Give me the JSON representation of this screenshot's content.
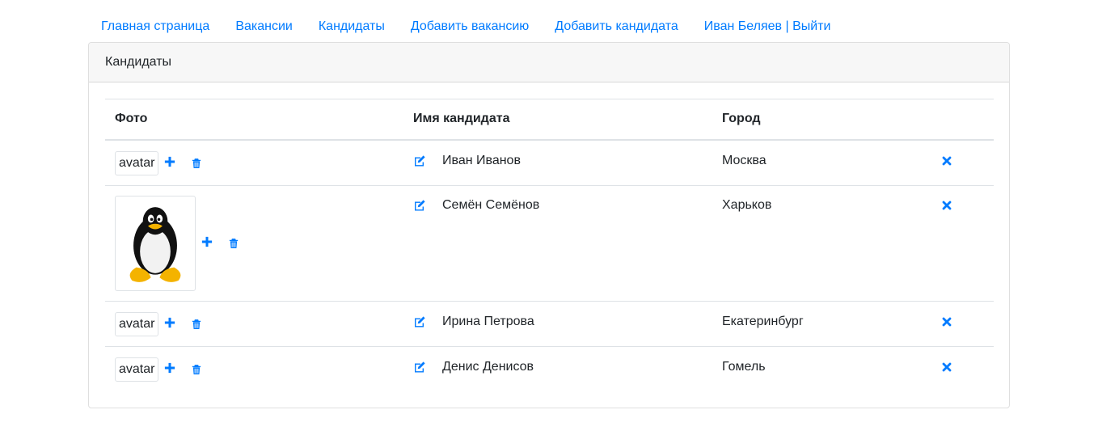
{
  "nav": {
    "items": [
      {
        "label": "Главная страница"
      },
      {
        "label": "Вакансии"
      },
      {
        "label": "Кандидаты"
      },
      {
        "label": "Добавить вакансию"
      },
      {
        "label": "Добавить кандидата"
      },
      {
        "label": "Иван Беляев | Выйти"
      }
    ]
  },
  "card": {
    "title": "Кандидаты",
    "columns": {
      "photo": "Фото",
      "name": "Имя кандидата",
      "city": "Город"
    }
  },
  "candidates": [
    {
      "photo": "avatar",
      "has_image": false,
      "name": "Иван Иванов",
      "city": "Москва"
    },
    {
      "photo": "",
      "has_image": true,
      "name": "Семён Семёнов",
      "city": "Харьков"
    },
    {
      "photo": "avatar",
      "has_image": false,
      "name": "Ирина Петрова",
      "city": "Екатеринбург"
    },
    {
      "photo": "avatar",
      "has_image": false,
      "name": "Денис Денисов",
      "city": "Гомель"
    }
  ],
  "icons": {
    "add": "plus-icon",
    "delete": "trash-icon",
    "edit": "edit-icon",
    "remove": "close-icon"
  },
  "colors": {
    "accent": "#007bff"
  }
}
